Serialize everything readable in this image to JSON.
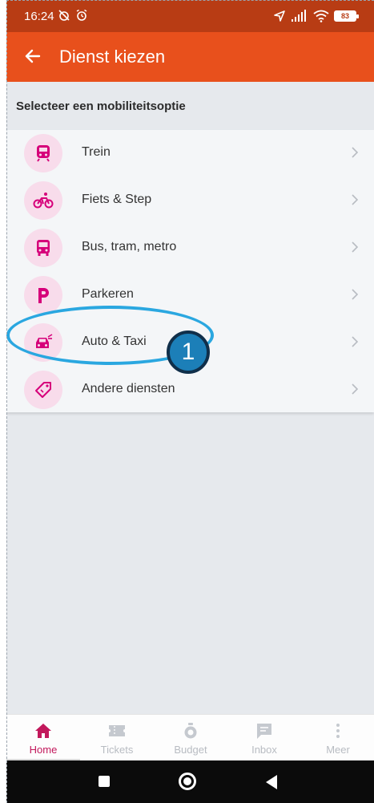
{
  "status_bar": {
    "time": "16:24",
    "left_icons": [
      "alarm-off-icon",
      "alarm-icon"
    ],
    "right_icons": [
      "location-icon",
      "signal-icon",
      "wifi-icon"
    ],
    "battery": "83"
  },
  "app_bar": {
    "title": "Dienst kiezen",
    "back_icon": "arrow-left-icon",
    "color": "#e8501c"
  },
  "section": {
    "title": "Selecteer een mobiliteitsoptie"
  },
  "list": {
    "items": [
      {
        "label": "Trein",
        "icon": "train-icon"
      },
      {
        "label": "Fiets & Step",
        "icon": "bike-icon"
      },
      {
        "label": "Bus, tram, metro",
        "icon": "bus-icon"
      },
      {
        "label": "Parkeren",
        "icon": "parking-icon"
      },
      {
        "label": "Auto & Taxi",
        "icon": "car-icon"
      },
      {
        "label": "Andere diensten",
        "icon": "tag-icon"
      }
    ],
    "icon_color": "#d6007a",
    "icon_bg": "#f8dceb"
  },
  "annotation": {
    "number": "1",
    "color": "#2aa7e0"
  },
  "bottom_nav": {
    "items": [
      {
        "label": "Home",
        "icon": "home-icon",
        "active": true
      },
      {
        "label": "Tickets",
        "icon": "ticket-icon",
        "active": false
      },
      {
        "label": "Budget",
        "icon": "budget-icon",
        "active": false
      },
      {
        "label": "Inbox",
        "icon": "inbox-icon",
        "active": false
      },
      {
        "label": "Meer",
        "icon": "more-vertical-icon",
        "active": false
      }
    ],
    "active_color": "#c2185b"
  },
  "system_nav": {
    "buttons": [
      "recents-icon",
      "home-circle-icon",
      "back-triangle-icon"
    ]
  }
}
